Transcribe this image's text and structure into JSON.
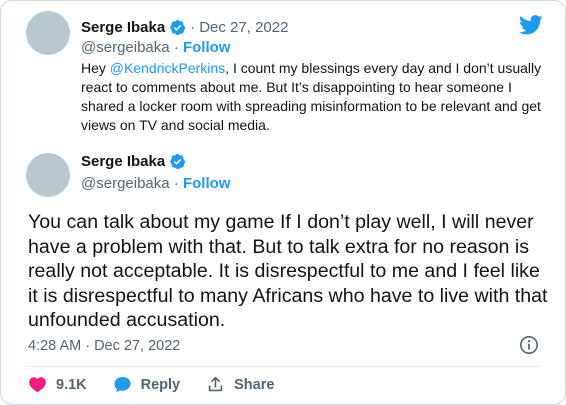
{
  "quoted_tweet": {
    "display_name": "Serge Ibaka",
    "separator": "·",
    "date": "Dec 27, 2022",
    "handle": "@sergeibaka",
    "follow_sep": "·",
    "follow_label": "Follow",
    "text_prefix": "Hey ",
    "mention": "@KendrickPerkins",
    "text_suffix": ", I count my blessings every day and I don’t usually react to comments about me. But It’s disappointing to hear someone I shared a locker room with spreading misinformation to be relevant and get views on TV and social media."
  },
  "main_tweet": {
    "display_name": "Serge Ibaka",
    "handle": "@sergeibaka",
    "follow_sep": "·",
    "follow_label": "Follow",
    "text": "You can talk about my game If I don’t play well, I will never have a problem with that. But to talk extra for no reason is really not acceptable. It is disrespectful to me and I feel like it is disrespectful to many Africans who have to live with that unfounded accusation.",
    "timestamp": "4:28 AM · Dec 27, 2022"
  },
  "actions": {
    "like_count": "9.1K",
    "reply_label": "Reply",
    "share_label": "Share"
  },
  "icons": {
    "brand": "twitter-bird-icon",
    "verified": "verified-badge-icon",
    "info": "info-icon",
    "like": "heart-icon",
    "reply": "speech-bubble-icon",
    "share": "share-icon"
  },
  "colors": {
    "accent": "#1d9bf0",
    "like": "#f91880",
    "text": "#0f1419",
    "muted": "#536471",
    "avatar_placeholder": "#b7c8d1"
  }
}
